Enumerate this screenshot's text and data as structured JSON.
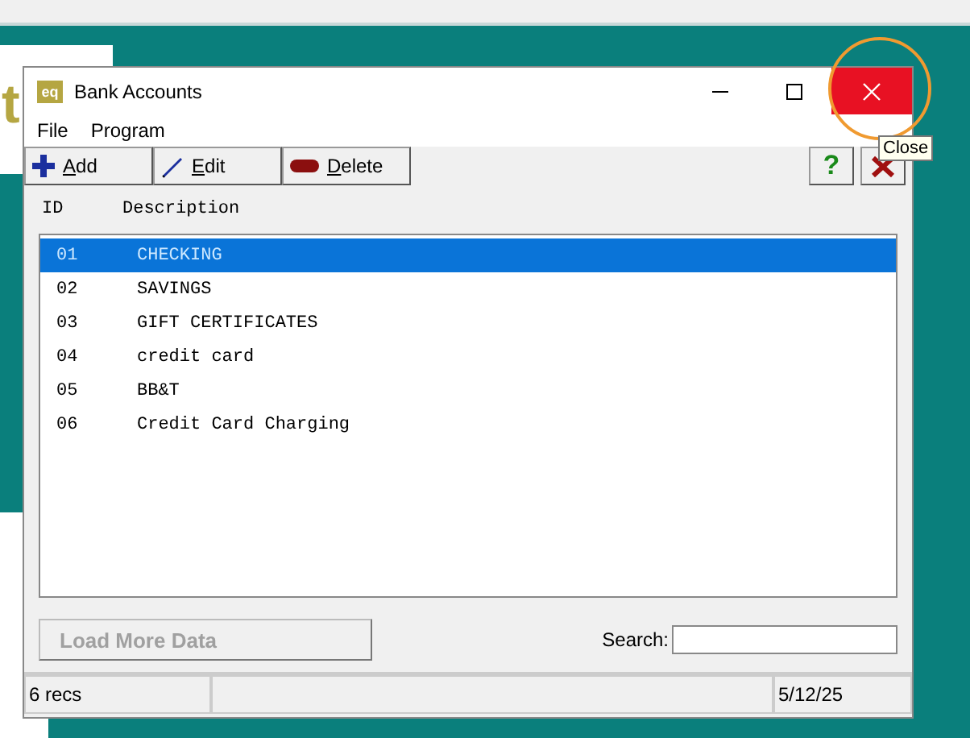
{
  "background_window": {
    "partial_text": "t"
  },
  "window": {
    "icon_text": "eq",
    "title": "Bank Accounts",
    "close_highlighted": true
  },
  "menu": [
    "File",
    "Program"
  ],
  "toolbar": [
    {
      "kind": "add",
      "label": "Add"
    },
    {
      "kind": "edit",
      "label": "Edit"
    },
    {
      "kind": "delete",
      "label": "Delete"
    }
  ],
  "help_button": "?",
  "tooltip": "Close",
  "table": {
    "columns": [
      "ID",
      "Description"
    ],
    "rows": [
      {
        "id": "01",
        "description": "CHECKING",
        "selected": true
      },
      {
        "id": "02",
        "description": "SAVINGS",
        "selected": false
      },
      {
        "id": "03",
        "description": "GIFT CERTIFICATES",
        "selected": false
      },
      {
        "id": "04",
        "description": "credit card",
        "selected": false
      },
      {
        "id": "05",
        "description": "BB&T",
        "selected": false
      },
      {
        "id": "06",
        "description": "Credit Card Charging",
        "selected": false
      }
    ]
  },
  "load_button": {
    "label": "Load More Data",
    "disabled": true
  },
  "search": {
    "label": "Search:"
  },
  "status_bar": {
    "records": "6 recs",
    "date": "5/12/25"
  }
}
